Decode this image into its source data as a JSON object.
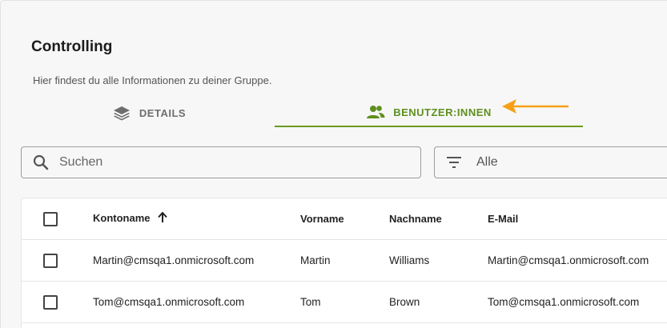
{
  "page": {
    "title": "Controlling",
    "subtitle": "Hier findest du alle Informationen zu deiner Gruppe."
  },
  "tabs": [
    {
      "label": "DETAILS",
      "icon": "layers-icon",
      "active": false
    },
    {
      "label": "BENUTZER:INNEN",
      "icon": "users-icon",
      "active": true
    }
  ],
  "annotation": {
    "icon": "orange-arrow-icon",
    "color": "#f5a017"
  },
  "search": {
    "placeholder": "Suchen",
    "value": ""
  },
  "filter": {
    "icon": "filter-list-icon",
    "selected": "Alle"
  },
  "table": {
    "columns": [
      "Kontoname",
      "Vorname",
      "Nachname",
      "E-Mail"
    ],
    "sort": {
      "column": "Kontoname",
      "direction": "ascending"
    },
    "rows": [
      {
        "kontoname": "Martin@cmsqa1.onmicrosoft.com",
        "vorname": "Martin",
        "nachname": "Williams",
        "email": "Martin@cmsqa1.onmicrosoft.com"
      },
      {
        "kontoname": "Tom@cmsqa1.onmicrosoft.com",
        "vorname": "Tom",
        "nachname": "Brown",
        "email": "Tom@cmsqa1.onmicrosoft.com"
      }
    ]
  },
  "colors": {
    "accent": "#6a9b24",
    "accent_text": "#5f8f1f",
    "arrow": "#f5a017"
  }
}
